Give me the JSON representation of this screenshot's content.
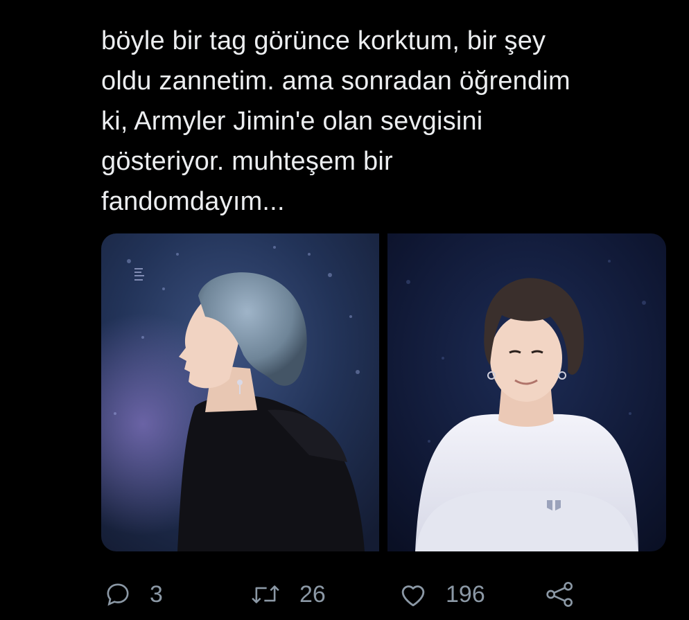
{
  "tweet": {
    "text_lines": [
      "böyle bir tag görünce korktum, bir şey",
      "oldu zannetim. ama sonradan öğrendim",
      "ki, Armyler Jimin'e olan sevgisini",
      "gösteriyor. muhteşem bir",
      "fandomdayım..."
    ],
    "media": [
      {
        "name": "photo-profile-grey-hair-black-hoodie"
      },
      {
        "name": "photo-smiling-white-sweatshirt"
      }
    ],
    "actions": {
      "reply": {
        "icon": "reply-icon",
        "count": "3"
      },
      "retweet": {
        "icon": "retweet-icon",
        "count": "26"
      },
      "like": {
        "icon": "heart-icon",
        "count": "196"
      },
      "share": {
        "icon": "share-icon"
      }
    }
  },
  "colors": {
    "background": "#000000",
    "text": "#eceef0",
    "muted": "#8b98a5"
  }
}
